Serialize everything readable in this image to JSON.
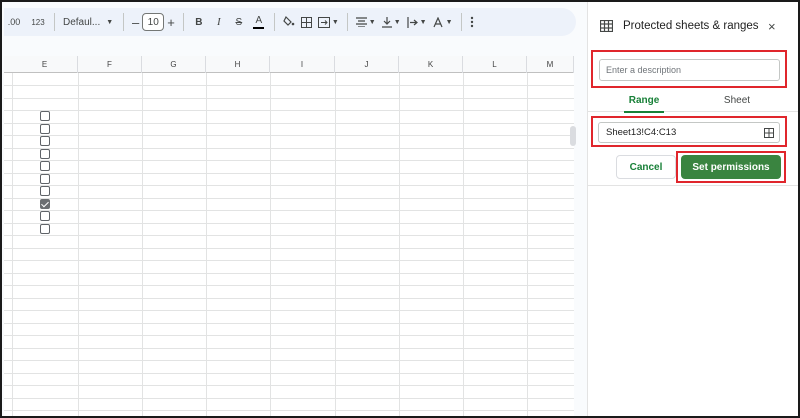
{
  "toolbar": {
    "decimal_label": ".00",
    "format_label": "123",
    "font_name": "Defaul...",
    "font_size": "10",
    "bold": "B",
    "italic": "I",
    "strike": "S",
    "text_color": "A",
    "icons": [
      "decrease-decimal-icon",
      "number-format-icon",
      "minus-icon",
      "plus-icon",
      "bold-icon",
      "italic-icon",
      "strikethrough-icon",
      "text-color-icon",
      "fill-color-icon",
      "borders-icon",
      "merge-cells-icon",
      "horizontal-align-icon",
      "vertical-align-icon",
      "text-wrap-icon",
      "text-rotation-icon",
      "more-vert-icon"
    ]
  },
  "sheet": {
    "columns": [
      "E",
      "F",
      "G",
      "H",
      "I",
      "J",
      "K",
      "L",
      "M"
    ],
    "checkboxes": [
      false,
      false,
      false,
      false,
      false,
      false,
      false,
      true,
      false,
      false
    ]
  },
  "panel": {
    "title": "Protected sheets & ranges",
    "close": "×",
    "description_placeholder": "Enter a description",
    "tabs": [
      "Range",
      "Sheet"
    ],
    "range_value": "Sheet13!C4:C13",
    "cancel_label": "Cancel",
    "set_permissions_label": "Set permissions"
  },
  "colors": {
    "accent_green": "#188038",
    "button_green": "#3a8440",
    "highlight_red": "#e0262c"
  }
}
